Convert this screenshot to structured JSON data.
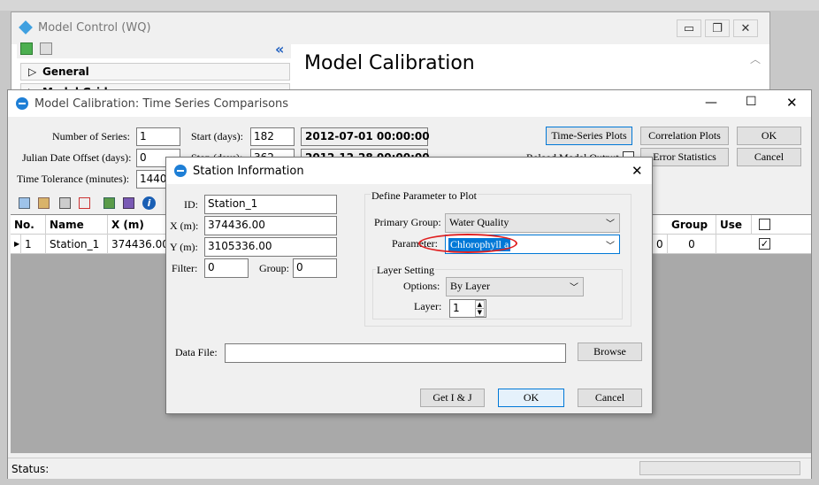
{
  "model_control": {
    "title": "Model Control (WQ)",
    "tree_items": [
      "General",
      "Model Grid"
    ],
    "panel_title": "Model Calibration"
  },
  "calibration": {
    "title": "Model Calibration: Time Series Comparisons",
    "number_of_series_label": "Number of Series:",
    "number_of_series": "1",
    "julian_offset_label": "Julian Date Offset (days):",
    "julian_offset": "0",
    "time_tolerance_label": "Time Tolerance  (minutes):",
    "time_tolerance": "1440",
    "start_label": "Start (days):",
    "start_value": "182",
    "start_date": "2012-07-01 00:00:00",
    "stop_label": "Stop (days):",
    "stop_value": "362",
    "stop_date": "2012-12-28 00:00:00",
    "btn_timeseries": "Time-Series Plots",
    "btn_correlation": "Correlation Plots",
    "btn_ok": "OK",
    "reload_label": "Reload Model Output",
    "btn_error": "Error Statistics",
    "btn_cancel": "Cancel",
    "table": {
      "headers": [
        "No.",
        "Name",
        "X (m)",
        "Group",
        "Use"
      ],
      "row": {
        "no": "1",
        "name": "Station_1",
        "x": "374436.00",
        "hidden_val": "0",
        "group": "0",
        "use": "✓"
      }
    },
    "status_label": "Status:"
  },
  "station": {
    "title": "Station Information",
    "id_label": "ID:",
    "id_value": "Station_1",
    "x_label": "X  (m):",
    "x_value": "374436.00",
    "y_label": "Y  (m):",
    "y_value": "3105336.00",
    "filter_label": "Filter:",
    "filter_value": "0",
    "group_label": "Group:",
    "group_value": "0",
    "define_legend": "Define Parameter to Plot",
    "primary_group_label": "Primary Group:",
    "primary_group_value": "Water Quality",
    "parameter_label": "Parameter:",
    "parameter_value": "Chlorophyll a",
    "layer_legend": "Layer Setting",
    "options_label": "Options:",
    "options_value": "By Layer",
    "layer_label": "Layer:",
    "layer_value": "1",
    "data_file_label": "Data File:",
    "data_file_value": "",
    "btn_browse": "Browse",
    "btn_getij": "Get I & J",
    "btn_ok": "OK",
    "btn_cancel": "Cancel"
  }
}
